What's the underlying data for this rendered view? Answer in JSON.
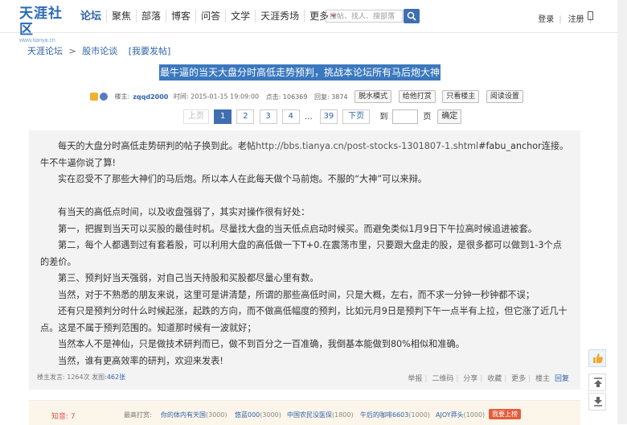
{
  "header": {
    "logo_text": "天涯社区",
    "logo_url_text": "www.tianya.cn",
    "nav": [
      "论坛",
      "聚焦",
      "部落",
      "博客",
      "问答",
      "文学",
      "天涯秀场",
      "更多"
    ],
    "search_placeholder": "搜帖、找人、搜部落",
    "login": "登录",
    "register": "注册"
  },
  "breadcrumb": {
    "root": "天涯论坛",
    "sep": ">",
    "board": "股市论谈",
    "action": "[我要发帖]"
  },
  "post_title": "最牛逼的当天大盘分时高低走势预判，挑战本论坛所有马后炮大神",
  "meta": {
    "author_label": "楼主:",
    "author": "zqqd2000",
    "time": "时间: 2015-01-15 19:09:00",
    "clicks": "点击: 106369",
    "replies": "回复: 3874",
    "buttons": [
      "脱水模式",
      "给他打赏",
      "只看楼主",
      "阅读设置"
    ]
  },
  "pager": {
    "prev": "上页",
    "pages": [
      "1",
      "2",
      "3",
      "4"
    ],
    "ellipsis": "…",
    "last": "39",
    "next": "下页",
    "goto": "到",
    "page_unit": "页",
    "confirm": "确定"
  },
  "body": {
    "p1_a": "每天的大盘分时高低走势研判的帖子换到此。老帖",
    "p1_url": "http://bbs.tianya.cn/post-stocks-1301807-1.shtml",
    "p1_b": "#fabu_anchor连接。牛不牛逼你说了算!",
    "p2": "实在忍受不了那些大神们的马后炮。所以本人在此每天做个马前炮。不服的“大神”可以来辩。",
    "p3": "有当天的高低点时间，以及收盘强弱了，其实对操作很有好处：",
    "p4": "第一，把握到当天可以买股的最佳时机。尽量找大盘的当天低点启动时候买。而避免类似1月9日下午拉高时候追进被套。",
    "p5": "第二，每个人都遇到过有套着股，可以利用大盘的高低做一下T+0.在震荡市里，只要跟大盘走的股，是很多都可以做到1-3个点的差价。",
    "p6": "第三、预判好当天强弱，对自己当天持股和买股都尽量心里有数。",
    "p7": "当然，对于不熟悉的朋友来说，这里可是讲清楚，所谓的那些高低时间，只是大概，左右，而不求一分钟一秒钟都不误；",
    "p8": "还有只是预判分时什么时候起涨，起跌的方向，而不做高低幅度的预判，比如元月9日是预判下午一点半有上拉，但它涨了近几十点。这是不属于预判范围的。知道那时候有一波就好；",
    "p9": "当然本人不是神仙，只是做技术研判而已，做不到百分之一百准确，我倒基本能做到80%相似和准确。",
    "p10": "当然，谁有更高效率的研判，欢迎来发表!"
  },
  "post_footer": {
    "label": "楼主发言: 1264次 发图:",
    "count": "462张",
    "actions": [
      "举报",
      "二维码",
      "分享",
      "收藏",
      "更多",
      "楼主",
      "回复"
    ]
  },
  "tip_bar": {
    "zhi": "知音: 7",
    "top_label": "最高打赏:",
    "tippers": [
      {
        "name": "你的体内有天国",
        "amount": "(3000)"
      },
      {
        "name": "悠蓝000",
        "amount": "(3000)"
      },
      {
        "name": "中国农民没医保",
        "amount": "(1800)"
      },
      {
        "name": "午后的咖啡6603",
        "amount": "(1000)"
      },
      {
        "name": "AJOY莽头",
        "amount": "(1000)"
      }
    ],
    "reward_button": "我要上榜"
  },
  "side_icons": [
    "thumb-up-icon",
    "scroll-top-icon",
    "scroll-bottom-icon"
  ]
}
